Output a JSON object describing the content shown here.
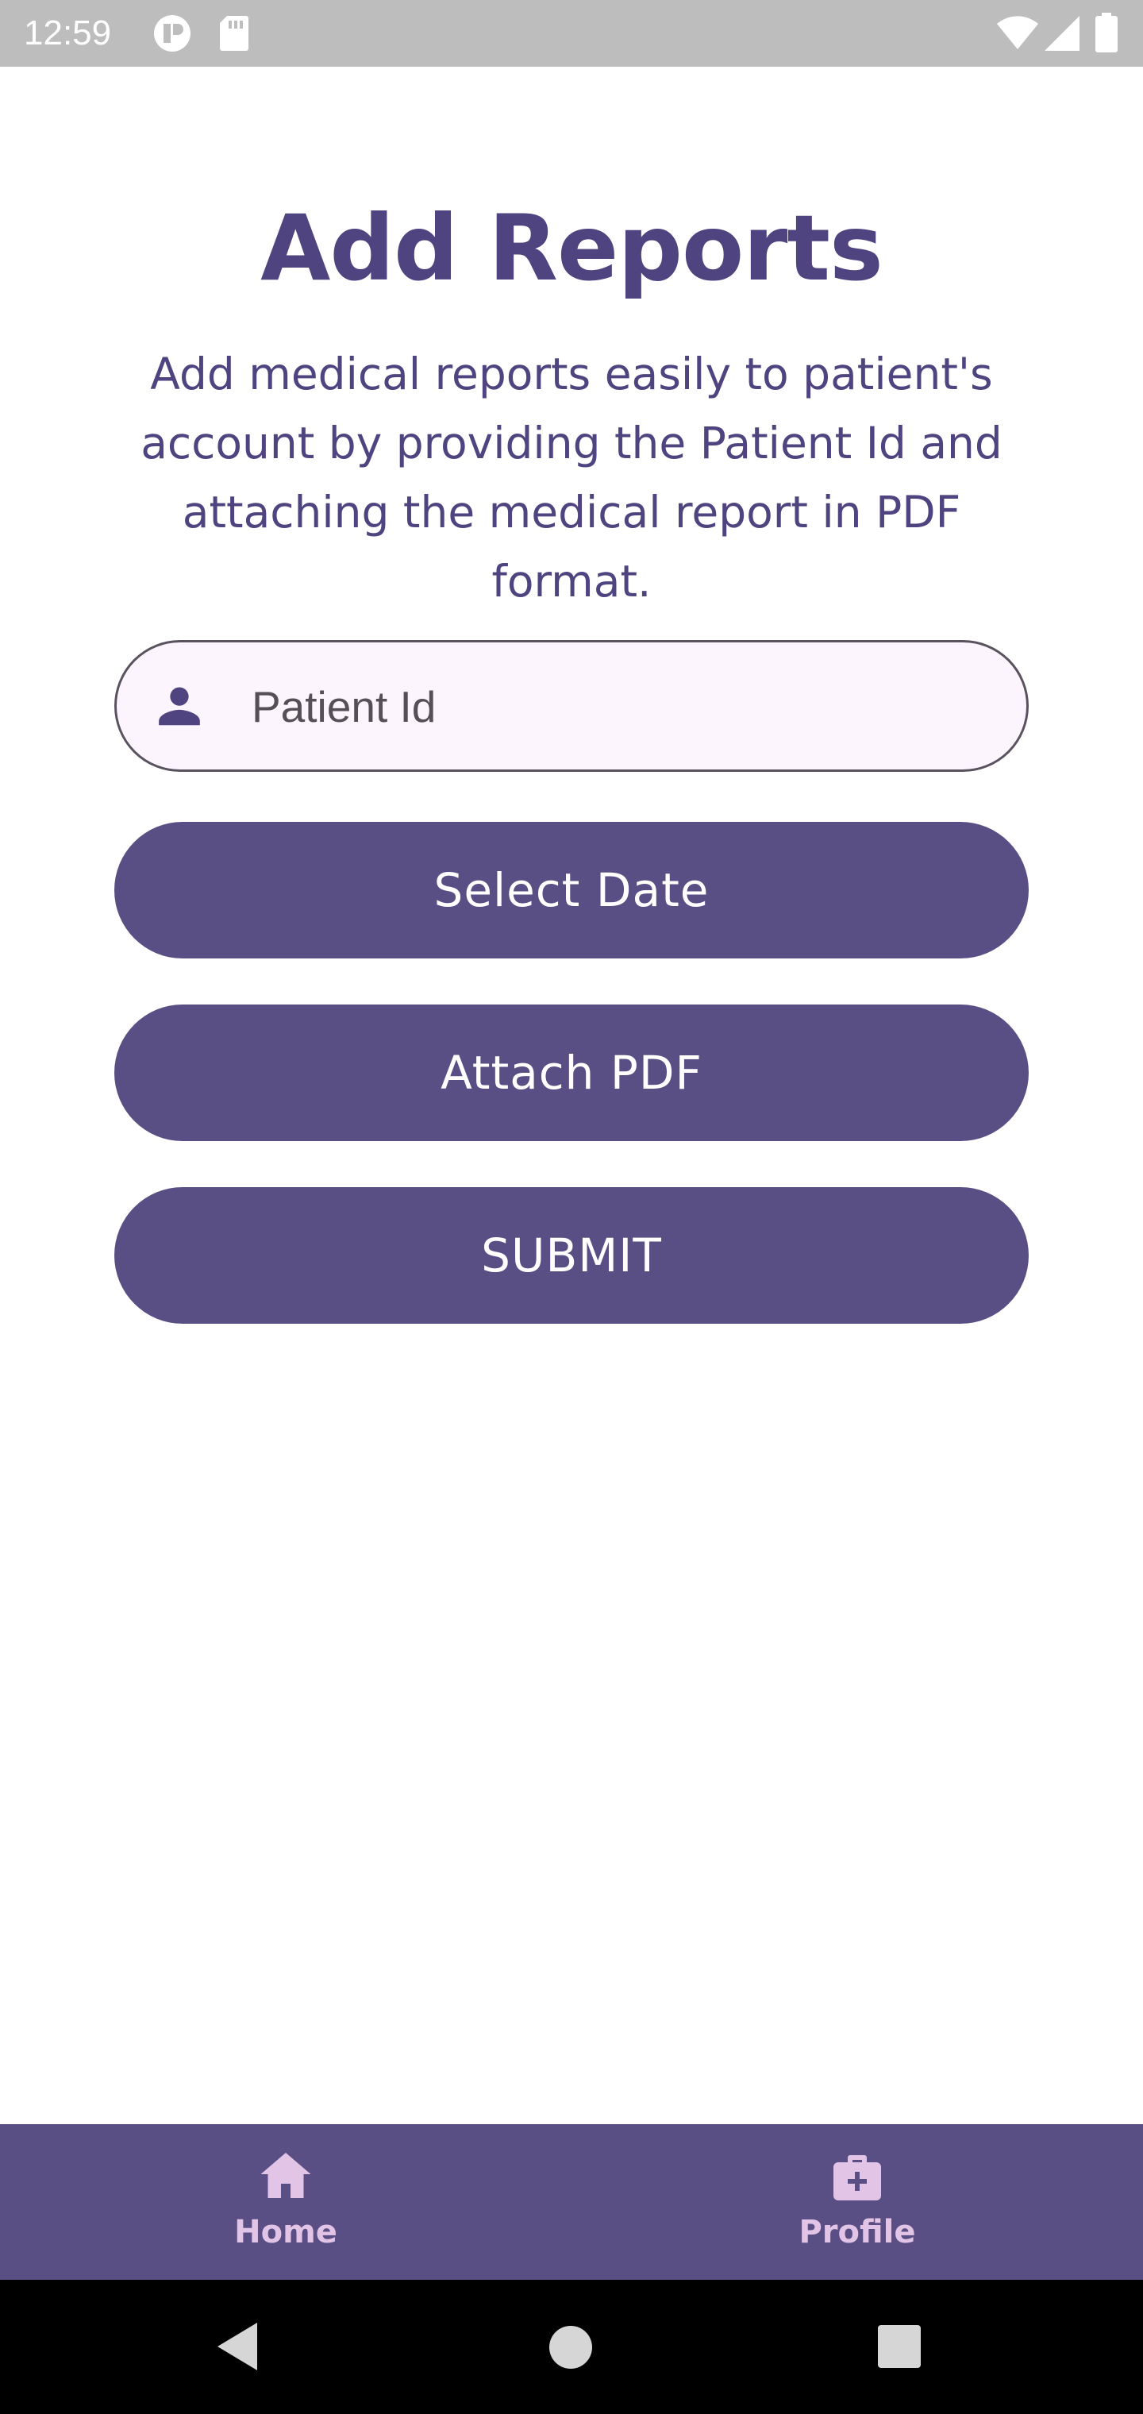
{
  "status_bar": {
    "time": "12:59",
    "icons": [
      "app-notification-icon",
      "sd-card-icon",
      "wifi-icon",
      "signal-icon",
      "battery-icon"
    ]
  },
  "page": {
    "title": "Add Reports",
    "description": "Add medical reports easily to patient's account by providing the Patient Id and attaching the medical report in PDF format."
  },
  "form": {
    "patient_id": {
      "placeholder": "Patient Id",
      "value": "",
      "icon": "person-icon"
    },
    "select_date_label": "Select Date",
    "attach_pdf_label": "Attach PDF",
    "submit_label": "SUBMIT"
  },
  "bottom_nav": {
    "items": [
      {
        "label": "Home",
        "icon": "home-icon"
      },
      {
        "label": "Profile",
        "icon": "medical-bag-icon"
      }
    ]
  },
  "system_nav": {
    "buttons": [
      "back-icon",
      "home-circle-icon",
      "recents-icon"
    ]
  },
  "colors": {
    "primary": "#5a4f84",
    "title_text": "#4f4480",
    "input_bg": "#fcf5fd",
    "nav_accent": "#e2c4e6",
    "status_bar": "#bdbdbd"
  }
}
